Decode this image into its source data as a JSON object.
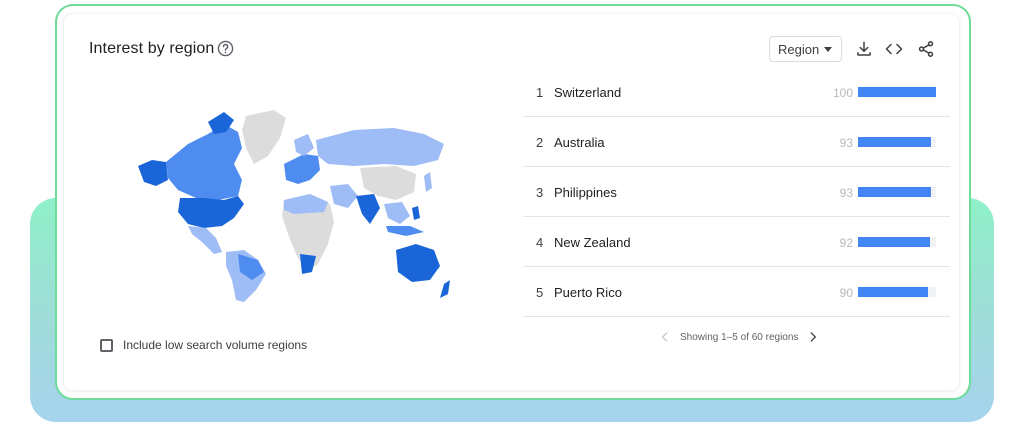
{
  "card": {
    "title": "Interest by region",
    "help_icon": "help-circle-icon",
    "region_select": {
      "selected": "Region",
      "icon": "caret-down-icon"
    },
    "toolbar": [
      "download-icon",
      "embed-code-icon",
      "share-icon"
    ]
  },
  "map": {
    "description_colors": {
      "high": "#1a66d8",
      "mid": "#4f8cf0",
      "low": "#9ebcf5",
      "none": "#dcdcdc"
    }
  },
  "checkbox": {
    "label": "Include low search volume regions",
    "checked": false
  },
  "regions": [
    {
      "rank": "1",
      "name": "Switzerland",
      "value": 100
    },
    {
      "rank": "2",
      "name": "Australia",
      "value": 93
    },
    {
      "rank": "3",
      "name": "Philippines",
      "value": 93
    },
    {
      "rank": "4",
      "name": "New Zealand",
      "value": 92
    },
    {
      "rank": "5",
      "name": "Puerto Rico",
      "value": 90
    }
  ],
  "pager": {
    "text": "Showing 1–5 of 60 regions"
  },
  "colors": {
    "bar": "#4285f4",
    "card_border": "#6ddc98",
    "glow_top": "#8ff0c8",
    "glow_bottom": "#a6d3ee"
  }
}
